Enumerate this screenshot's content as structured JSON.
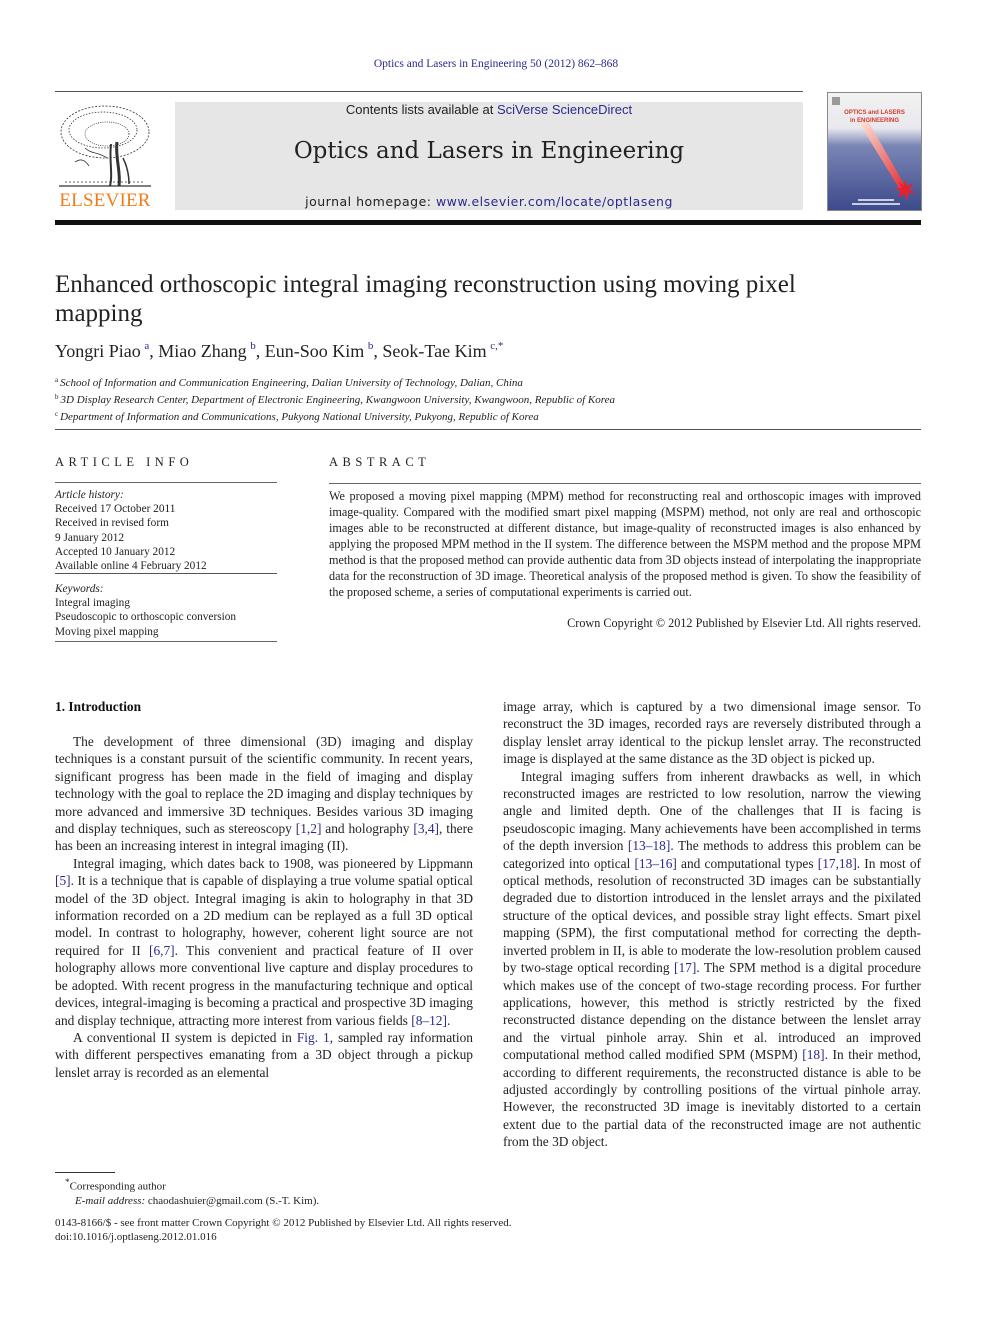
{
  "running_header": "Optics and Lasers in Engineering 50 (2012) 862–868",
  "masthead": {
    "publisher_logo_text": "ELSEVIER",
    "contents_prefix": "Contents lists available at ",
    "contents_link": "SciVerse ScienceDirect",
    "journal_title": "Optics and Lasers in Engineering",
    "homepage_prefix": "journal homepage: ",
    "homepage_link": "www.elsevier.com/locate/optlaseng",
    "cover_title_line1": "OPTICS and LASERS",
    "cover_title_line2": "in ENGINEERING"
  },
  "article": {
    "title": "Enhanced orthoscopic integral imaging reconstruction using moving pixel mapping",
    "authors": [
      {
        "name": "Yongri Piao",
        "aff": "a",
        "sep": ", "
      },
      {
        "name": "Miao Zhang",
        "aff": "b",
        "sep": ", "
      },
      {
        "name": "Eun-Soo Kim",
        "aff": "b",
        "sep": ", "
      },
      {
        "name": "Seok-Tae Kim",
        "aff": "c,*",
        "sep": ""
      }
    ],
    "affiliations": [
      {
        "key": "a",
        "text": "School of Information and Communication Engineering, Dalian University of Technology, Dalian, China"
      },
      {
        "key": "b",
        "text": "3D Display Research Center, Department of Electronic Engineering, Kwangwoon University, Kwangwoon, Republic of Korea"
      },
      {
        "key": "c",
        "text": "Department of Information and Communications, Pukyong National University, Pukyong, Republic of Korea"
      }
    ]
  },
  "article_info": {
    "heading": "ARTICLE INFO",
    "history_label": "Article history:",
    "history": [
      "Received 17 October 2011",
      "Received in revised form",
      "9 January 2012",
      "Accepted 10 January 2012",
      "Available online 4 February 2012"
    ],
    "keywords_label": "Keywords:",
    "keywords": [
      "Integral imaging",
      "Pseudoscopic to orthoscopic conversion",
      "Moving pixel mapping"
    ]
  },
  "abstract": {
    "heading": "ABSTRACT",
    "text": "We proposed a moving pixel mapping (MPM) method for reconstructing real and orthoscopic images with improved image-quality. Compared with the modified smart pixel mapping (MSPM) method, not only are real and orthoscopic images able to be reconstructed at different distance, but image-quality of reconstructed images is also enhanced by applying the proposed MPM method in the II system. The difference between the MSPM method and the propose MPM method is that the proposed method can provide authentic data from 3D objects instead of interpolating the inappropriate data for the reconstruction of 3D image. Theoretical analysis of the proposed method is given. To show the feasibility of the proposed scheme, a series of computational experiments is carried out.",
    "copyright": "Crown Copyright © 2012 Published by Elsevier Ltd. All rights reserved."
  },
  "body": {
    "section_heading": "1.  Introduction",
    "left_paragraphs": [
      {
        "parts": [
          {
            "t": "The development of three dimensional (3D) imaging and display techniques is a constant pursuit of the scientific community. In recent years, significant progress has been made in the field of imaging and display technology with the goal to replace the 2D imaging and display techniques by more advanced and immersive 3D techniques. Besides various 3D imaging and display techniques, such as stereoscopy "
          },
          {
            "t": "[1,2]",
            "link": true
          },
          {
            "t": " and holography "
          },
          {
            "t": "[3,4]",
            "link": true
          },
          {
            "t": ", there has been an increasing interest in integral imaging (II)."
          }
        ]
      },
      {
        "parts": [
          {
            "t": "Integral imaging, which dates back to 1908, was pioneered by Lippmann "
          },
          {
            "t": "[5]",
            "link": true
          },
          {
            "t": ". It is a technique that is capable of displaying a true volume spatial optical model of the 3D object. Integral imaging is akin to holography in that 3D information recorded on a 2D medium can be replayed as a full 3D optical model. In contrast to holography, however, coherent light source are not required for II "
          },
          {
            "t": "[6,7]",
            "link": true
          },
          {
            "t": ". This convenient and practical feature of II over holography allows more conventional live capture and display procedures to be adopted. With recent progress in the manufacturing technique and optical devices, integral-imaging is becoming a practical and prospective 3D imaging and display technique, attracting more interest from various fields "
          },
          {
            "t": "[8–12]",
            "link": true
          },
          {
            "t": "."
          }
        ]
      },
      {
        "parts": [
          {
            "t": "A conventional II system is depicted in "
          },
          {
            "t": "Fig. 1",
            "link": true
          },
          {
            "t": ", sampled ray information with different perspectives emanating from a 3D object through a pickup lenslet array is recorded as an elemental"
          }
        ]
      }
    ],
    "right_paragraphs": [
      {
        "noindent": true,
        "parts": [
          {
            "t": "image array, which is captured by a two dimensional image sensor. To reconstruct the 3D images, recorded rays are reversely distributed through a display lenslet array identical to the pickup lenslet array. The reconstructed image is displayed at the same distance as the 3D object is picked up."
          }
        ]
      },
      {
        "parts": [
          {
            "t": "Integral imaging suffers from inherent drawbacks as well, in which reconstructed images are restricted to low resolution, narrow the viewing angle and limited depth. One of the challenges that II is facing is pseudoscopic imaging. Many achievements have been accomplished in terms of the depth inversion "
          },
          {
            "t": "[13–18]",
            "link": true
          },
          {
            "t": ". The methods to address this problem can be categorized into optical "
          },
          {
            "t": "[13–16]",
            "link": true
          },
          {
            "t": " and computational types "
          },
          {
            "t": "[17,18]",
            "link": true
          },
          {
            "t": ". In most of optical methods, resolution of reconstructed 3D images can be substantially degraded due to distortion introduced in the lenslet arrays and the pixilated structure of the optical devices, and possible stray light effects. Smart pixel mapping (SPM), the first computational method for correcting the depth-inverted problem in II, is able to moderate the low-resolution problem caused by two-stage optical recording "
          },
          {
            "t": "[17]",
            "link": true
          },
          {
            "t": ". The SPM method is a digital procedure which makes use of the concept of two-stage recording process. For further applications, however, this method is strictly restricted by the fixed reconstructed distance depending on the distance between the lenslet array and the virtual pinhole array. Shin et al. introduced an improved computational method called modified SPM (MSPM) "
          },
          {
            "t": "[18]",
            "link": true
          },
          {
            "t": ". In their method, according to different requirements, the reconstructed distance is able to be adjusted accordingly by controlling positions of the virtual pinhole array. However, the reconstructed 3D image is inevitably distorted to a certain extent due to the partial data of the reconstructed image are not authentic from the 3D object."
          }
        ]
      }
    ]
  },
  "footnote": {
    "corresponding_mark": "*",
    "corresponding_label": "Corresponding author",
    "email_label": "E-mail address:",
    "email_value": "chaodashuier@gmail.com (S.-T. Kim)."
  },
  "front_matter": {
    "line1": "0143-8166/$ - see front matter Crown Copyright © 2012 Published by Elsevier Ltd. All rights reserved.",
    "doi": "doi:10.1016/j.optlaseng.2012.01.016"
  },
  "colors": {
    "link": "#2a2a8c",
    "elsevier_orange": "#f07d1a",
    "masthead_box": "#e6e6e6"
  }
}
